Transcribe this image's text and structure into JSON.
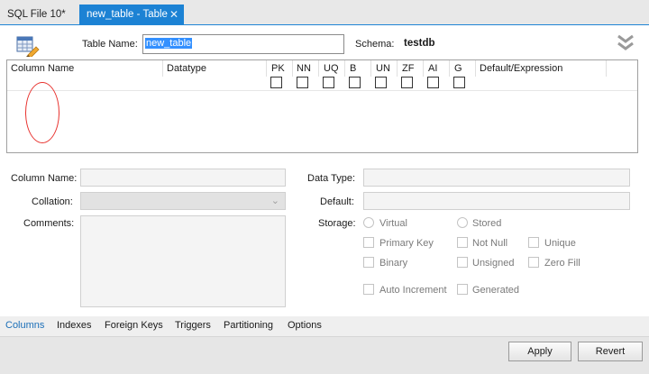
{
  "tabs": [
    {
      "label": "SQL File 10*",
      "active": false
    },
    {
      "label": "new_table - Table",
      "active": true
    }
  ],
  "header": {
    "table_name_label": "Table Name:",
    "table_name_value": "new_table",
    "schema_label": "Schema:",
    "schema_value": "testdb"
  },
  "grid": {
    "columns": [
      "Column Name",
      "Datatype",
      "PK",
      "NN",
      "UQ",
      "B",
      "UN",
      "ZF",
      "AI",
      "G",
      "Default/Expression"
    ]
  },
  "details": {
    "column_name_label": "Column Name:",
    "collation_label": "Collation:",
    "comments_label": "Comments:",
    "data_type_label": "Data Type:",
    "default_label": "Default:",
    "storage_label": "Storage:",
    "storage_options": [
      "Virtual",
      "Stored"
    ],
    "flags": [
      "Primary Key",
      "Not Null",
      "Unique",
      "Binary",
      "Unsigned",
      "Zero Fill",
      "Auto Increment",
      "Generated"
    ]
  },
  "bottom_tabs": [
    "Columns",
    "Indexes",
    "Foreign Keys",
    "Triggers",
    "Partitioning",
    "Options"
  ],
  "actions": {
    "apply": "Apply",
    "revert": "Revert"
  },
  "colors": {
    "accent": "#1c82d4",
    "annotation": "#e8332f"
  }
}
